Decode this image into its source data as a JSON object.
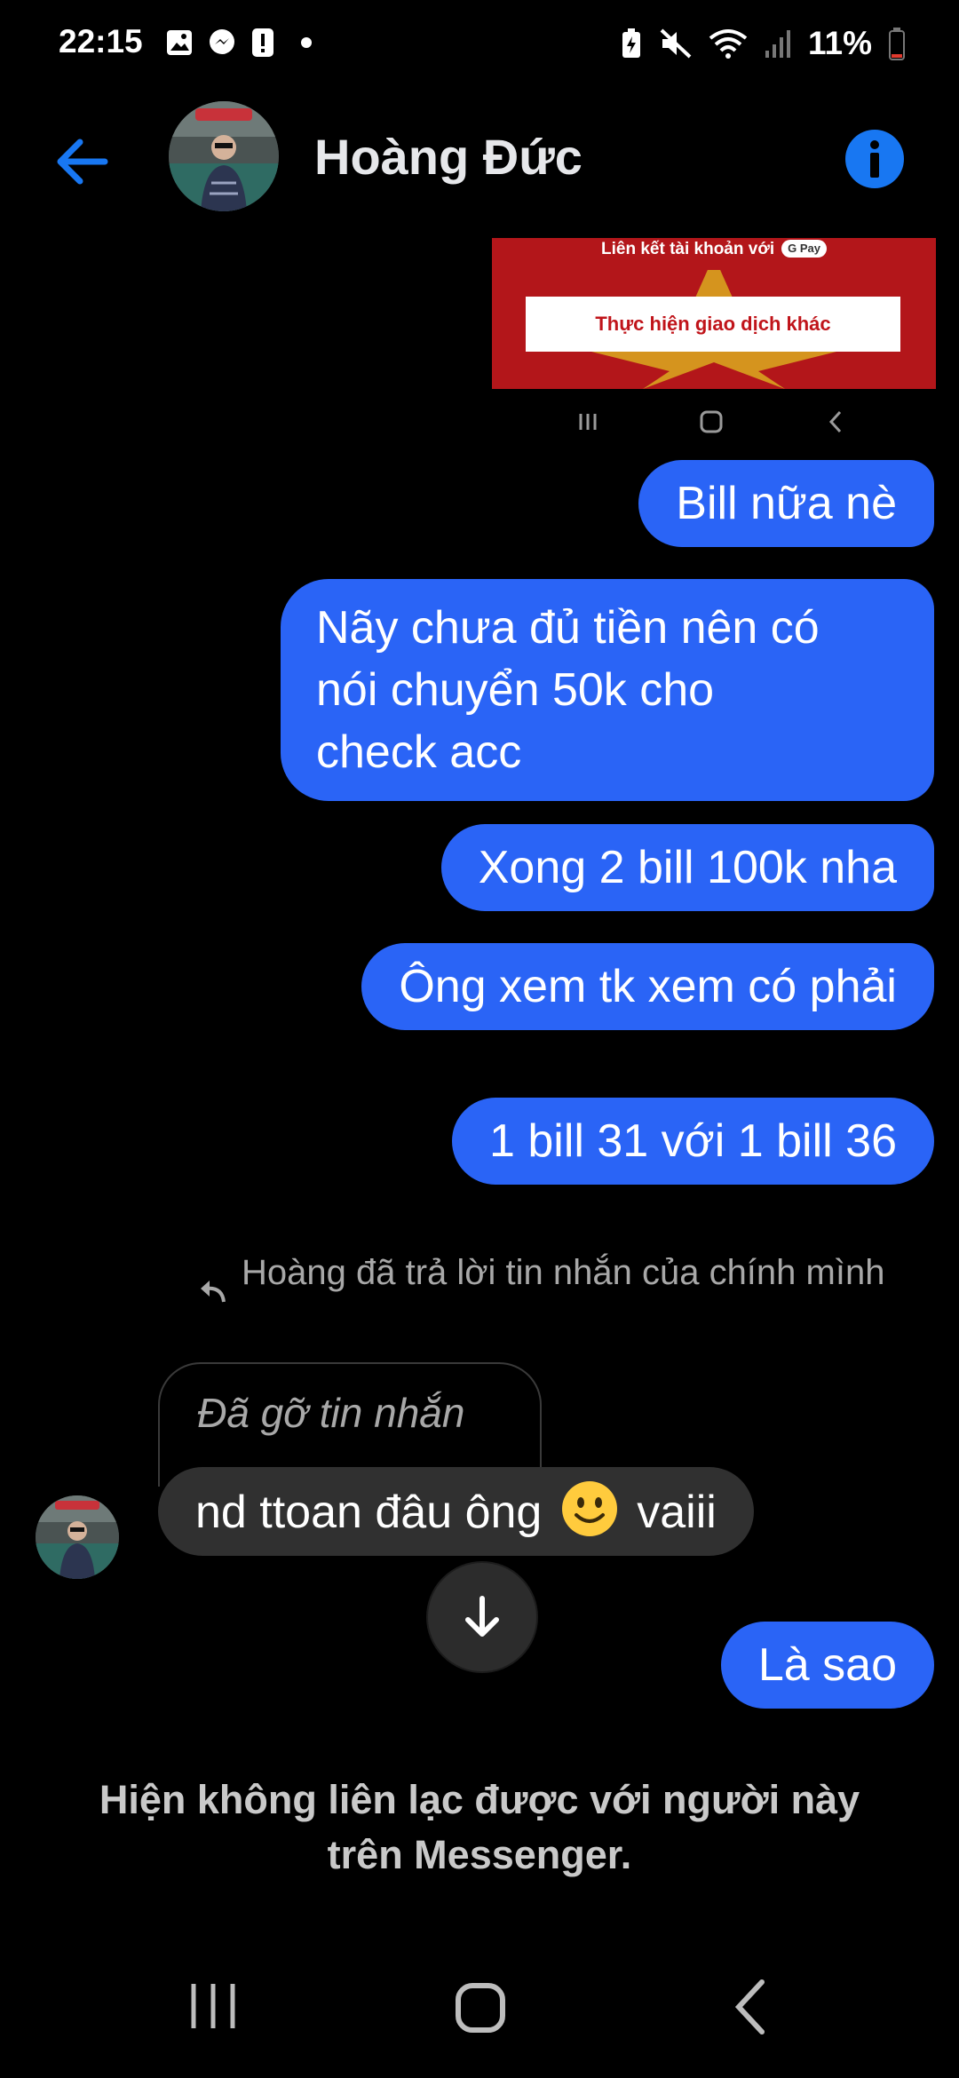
{
  "status_bar": {
    "time": "22:15",
    "battery_percent": "11%",
    "left_icons": [
      "gallery-icon",
      "messenger-icon",
      "alert-icon",
      "dot"
    ],
    "right_icons": [
      "battery-saver-icon",
      "mute-icon",
      "wifi-icon",
      "signal-icon",
      "battery-icon"
    ]
  },
  "header": {
    "contact_name": "Hoàng Đức",
    "back_icon": "back-arrow-icon",
    "info_icon": "info-icon"
  },
  "shared_image": {
    "top_text": "Liên kết tài khoản với",
    "gpay_label": "G Pay",
    "button_text": "Thực hiện giao dịch khác"
  },
  "messages": {
    "out_1": "Bill nữa nè",
    "out_2_line1": "Nãy chưa đủ tiền nên có",
    "out_2_line2": "nói chuyển 50k cho",
    "out_2_line3": "check acc",
    "out_3": "Xong 2 bill 100k nha",
    "out_4": "Ông xem tk xem có phải",
    "out_5": "1 bill 31 với 1 bill 36",
    "reply_note": "Hoàng đã trả lời tin nhắn của chính mình",
    "unsent": "Đã gỡ tin nhắn",
    "in_1_part1": "nd ttoan đâu ông",
    "in_1_part2": "vaiii",
    "out_6": "Là sao"
  },
  "notice": {
    "line1": "Hiện không liên lạc được với người này",
    "line2": "trên Messenger."
  },
  "colors": {
    "outgoing_bubble": "#2a64f6",
    "incoming_bubble": "#303030",
    "accent": "#1877f2",
    "background": "#000000"
  }
}
